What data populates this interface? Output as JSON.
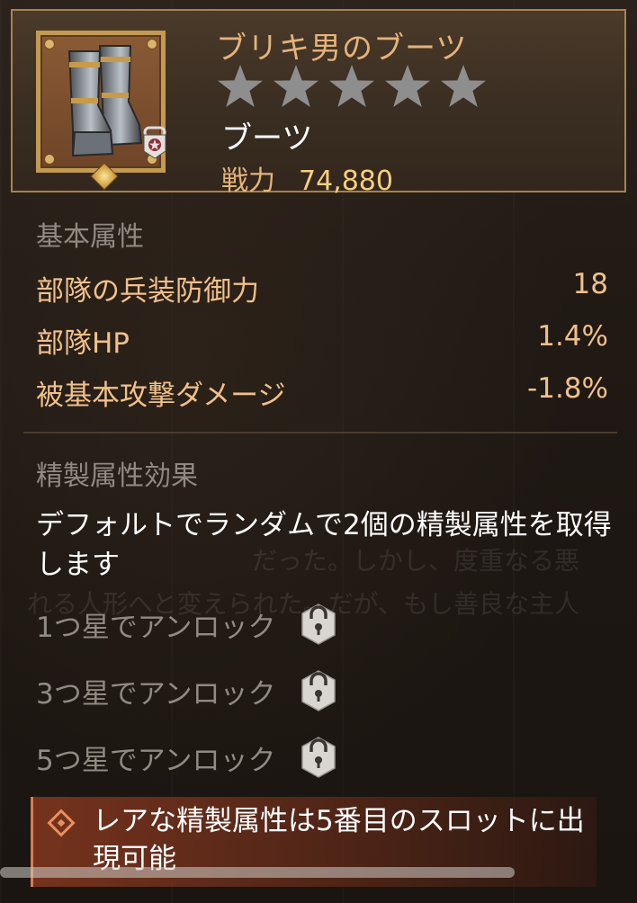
{
  "item": {
    "name": "ブリキ男のブーツ",
    "star_count": 5,
    "type": "ブーツ",
    "power_label": "戦力",
    "power_value": "74,880",
    "icon": "iron-boots-icon"
  },
  "base_attributes": {
    "title": "基本属性",
    "rows": [
      {
        "label": "部隊の兵装防御力",
        "value": "18"
      },
      {
        "label": "部隊HP",
        "value": "1.4%"
      },
      {
        "label": "被基本攻撃ダメージ",
        "value": "-1.8%"
      }
    ]
  },
  "refine": {
    "title": "精製属性効果",
    "description": "デフォルトでランダムで2個の精製属性を取得します",
    "unlocks": [
      {
        "label": "1つ星でアンロック",
        "icon": "lock-icon"
      },
      {
        "label": "3つ星でアンロック",
        "icon": "lock-icon"
      },
      {
        "label": "5つ星でアンロック",
        "icon": "lock-icon"
      }
    ]
  },
  "rare_note": {
    "text": "レアな精製属性は5番目のスロットに出現可能",
    "icon": "diamond-icon"
  },
  "background_text": [
    "だった。しかし、度重なる悪",
    "れる人形へと変えられた。だが、もし善良な主人"
  ],
  "colors": {
    "gold_text": "#e4b37a",
    "power_value": "#f6cf7e",
    "star": "#8e8e8e",
    "muted": "#8f8a82",
    "rare_accent": "#e8905f"
  }
}
